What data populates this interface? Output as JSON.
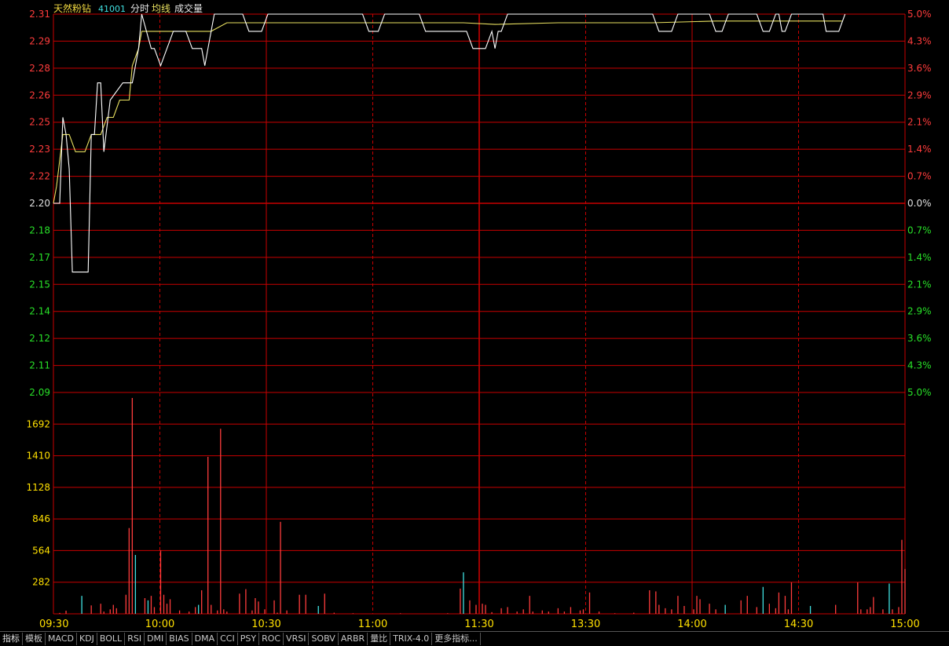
{
  "header": {
    "name": "天然粉钻",
    "code": "41001",
    "tag_minute": "分时",
    "tag_avg": "均线",
    "tag_volume": "成交量"
  },
  "colors": {
    "grid": "#c80000",
    "up": "#ff3c3c",
    "down": "#28e028",
    "neutral": "#e0e0e0",
    "price_line": "#ffffff",
    "avg_line": "#e8e060",
    "vol_up": "#ff3c3c",
    "vol_down": "#40e0e0",
    "vol_label": "#ffe000",
    "code": "#40e0e0",
    "tag": "#e8e060"
  },
  "price_axis": {
    "left_labels": [
      "2.31",
      "2.29",
      "2.28",
      "2.26",
      "2.25",
      "2.23",
      "2.22",
      "2.20",
      "2.18",
      "2.17",
      "2.15",
      "2.14",
      "2.12",
      "2.11",
      "2.09"
    ],
    "right_labels": [
      "5.0%",
      "4.3%",
      "3.6%",
      "2.9%",
      "2.1%",
      "1.4%",
      "0.7%",
      "0.0%",
      "0.7%",
      "1.4%",
      "2.1%",
      "2.9%",
      "3.6%",
      "4.3%",
      "5.0%"
    ],
    "base_index": 7,
    "prev_close": 2.2,
    "max": 2.31,
    "min": 2.09
  },
  "volume_axis": {
    "labels": [
      "1692",
      "1410",
      "1128",
      "846",
      "564",
      "282"
    ],
    "max": 1974
  },
  "time_axis": {
    "labels": [
      "09:30",
      "10:00",
      "10:30",
      "11:00",
      "11:30",
      "13:30",
      "14:00",
      "14:30",
      "15:00"
    ]
  },
  "chart_data": {
    "type": "line",
    "x_range": [
      "09:30",
      "15:00"
    ],
    "total_minutes": 240,
    "price_series": {
      "name": "分时",
      "points": [
        [
          0,
          2.2
        ],
        [
          2,
          2.2
        ],
        [
          3,
          2.25
        ],
        [
          4,
          2.24
        ],
        [
          5,
          2.22
        ],
        [
          6,
          2.16
        ],
        [
          11,
          2.16
        ],
        [
          12,
          2.24
        ],
        [
          13,
          2.24
        ],
        [
          14,
          2.27
        ],
        [
          15,
          2.27
        ],
        [
          16,
          2.23
        ],
        [
          18,
          2.26
        ],
        [
          22,
          2.27
        ],
        [
          25,
          2.27
        ],
        [
          27,
          2.29
        ],
        [
          28,
          2.31
        ],
        [
          31,
          2.29
        ],
        [
          32,
          2.29
        ],
        [
          34,
          2.28
        ],
        [
          36,
          2.29
        ],
        [
          38,
          2.3
        ],
        [
          42,
          2.3
        ],
        [
          44,
          2.29
        ],
        [
          47,
          2.29
        ],
        [
          48,
          2.28
        ],
        [
          49,
          2.29
        ],
        [
          51,
          2.31
        ],
        [
          60,
          2.31
        ],
        [
          62,
          2.3
        ],
        [
          66,
          2.3
        ],
        [
          68,
          2.31
        ],
        [
          98,
          2.31
        ],
        [
          100,
          2.3
        ],
        [
          103,
          2.3
        ],
        [
          105,
          2.31
        ],
        [
          116,
          2.31
        ],
        [
          118,
          2.3
        ],
        [
          131,
          2.3
        ],
        [
          133,
          2.29
        ],
        [
          137,
          2.29
        ],
        [
          139,
          2.3
        ],
        [
          140,
          2.29
        ],
        [
          141,
          2.3
        ],
        [
          142,
          2.3
        ],
        [
          144,
          2.31
        ],
        [
          190,
          2.31
        ],
        [
          192,
          2.3
        ],
        [
          196,
          2.3
        ],
        [
          198,
          2.31
        ],
        [
          208,
          2.31
        ],
        [
          210,
          2.3
        ],
        [
          212,
          2.3
        ],
        [
          214,
          2.31
        ],
        [
          223,
          2.31
        ],
        [
          225,
          2.3
        ],
        [
          227,
          2.3
        ],
        [
          229,
          2.31
        ],
        [
          230,
          2.31
        ],
        [
          231,
          2.3
        ],
        [
          232,
          2.3
        ],
        [
          234,
          2.31
        ],
        [
          244,
          2.31
        ],
        [
          245,
          2.3
        ],
        [
          249,
          2.3
        ],
        [
          251,
          2.31
        ]
      ]
    },
    "avg_series": {
      "name": "均线",
      "points": [
        [
          0,
          2.2
        ],
        [
          1,
          2.21
        ],
        [
          3,
          2.24
        ],
        [
          5,
          2.24
        ],
        [
          7,
          2.23
        ],
        [
          10,
          2.23
        ],
        [
          12,
          2.24
        ],
        [
          15,
          2.24
        ],
        [
          17,
          2.25
        ],
        [
          19,
          2.25
        ],
        [
          21,
          2.26
        ],
        [
          24,
          2.26
        ],
        [
          25,
          2.28
        ],
        [
          27,
          2.29
        ],
        [
          28,
          2.3
        ],
        [
          33,
          2.3
        ],
        [
          38,
          2.3
        ],
        [
          40,
          2.3
        ],
        [
          50,
          2.3
        ],
        [
          55,
          2.305
        ],
        [
          60,
          2.305
        ],
        [
          80,
          2.305
        ],
        [
          110,
          2.305
        ],
        [
          130,
          2.305
        ],
        [
          140,
          2.304
        ],
        [
          160,
          2.305
        ],
        [
          190,
          2.305
        ],
        [
          210,
          2.306
        ],
        [
          250,
          2.306
        ]
      ]
    },
    "volume_bars": {
      "name": "成交量",
      "bars": [
        [
          2,
          8,
          "up"
        ],
        [
          4,
          28,
          "up"
        ],
        [
          9,
          160,
          "down"
        ],
        [
          12,
          75,
          "up"
        ],
        [
          15,
          90,
          "up"
        ],
        [
          16,
          20,
          "up"
        ],
        [
          18,
          40,
          "up"
        ],
        [
          19,
          80,
          "up"
        ],
        [
          20,
          50,
          "up"
        ],
        [
          23,
          170,
          "up"
        ],
        [
          24,
          765,
          "up"
        ],
        [
          25,
          1925,
          "up"
        ],
        [
          26,
          525,
          "down"
        ],
        [
          29,
          140,
          "up"
        ],
        [
          30,
          120,
          "down"
        ],
        [
          31,
          160,
          "up"
        ],
        [
          32,
          60,
          "up"
        ],
        [
          34,
          565,
          "up"
        ],
        [
          35,
          170,
          "up"
        ],
        [
          36,
          90,
          "up"
        ],
        [
          37,
          130,
          "up"
        ],
        [
          40,
          30,
          "up"
        ],
        [
          43,
          20,
          "up"
        ],
        [
          45,
          60,
          "up"
        ],
        [
          46,
          80,
          "down"
        ],
        [
          47,
          210,
          "up"
        ],
        [
          49,
          1400,
          "up"
        ],
        [
          50,
          80,
          "up"
        ],
        [
          52,
          30,
          "up"
        ],
        [
          53,
          1650,
          "up"
        ],
        [
          54,
          40,
          "up"
        ],
        [
          55,
          20,
          "up"
        ],
        [
          59,
          180,
          "up"
        ],
        [
          61,
          220,
          "up"
        ],
        [
          63,
          30,
          "up"
        ],
        [
          64,
          140,
          "up"
        ],
        [
          65,
          110,
          "up"
        ],
        [
          67,
          40,
          "up"
        ],
        [
          70,
          120,
          "up"
        ],
        [
          71,
          10,
          "up"
        ],
        [
          72,
          820,
          "up"
        ],
        [
          74,
          30,
          "up"
        ],
        [
          78,
          170,
          "up"
        ],
        [
          80,
          170,
          "up"
        ],
        [
          84,
          70,
          "down"
        ],
        [
          86,
          180,
          "up"
        ],
        [
          89,
          10,
          "up"
        ],
        [
          95,
          5,
          "up"
        ],
        [
          110,
          5,
          "up"
        ],
        [
          125,
          5,
          "up"
        ],
        [
          129,
          225,
          "up"
        ],
        [
          130,
          370,
          "down"
        ],
        [
          132,
          120,
          "up"
        ],
        [
          134,
          80,
          "up"
        ],
        [
          136,
          90,
          "up"
        ],
        [
          137,
          80,
          "up"
        ],
        [
          139,
          15,
          "up"
        ],
        [
          142,
          50,
          "up"
        ],
        [
          144,
          60,
          "up"
        ],
        [
          147,
          20,
          "up"
        ],
        [
          149,
          40,
          "up"
        ],
        [
          151,
          160,
          "up"
        ],
        [
          152,
          20,
          "up"
        ],
        [
          155,
          30,
          "up"
        ],
        [
          157,
          20,
          "up"
        ],
        [
          160,
          50,
          "up"
        ],
        [
          162,
          20,
          "up"
        ],
        [
          164,
          60,
          "up"
        ],
        [
          167,
          30,
          "up"
        ],
        [
          168,
          40,
          "up"
        ],
        [
          170,
          190,
          "up"
        ],
        [
          173,
          20,
          "up"
        ],
        [
          178,
          5,
          "up"
        ],
        [
          184,
          10,
          "up"
        ],
        [
          189,
          210,
          "up"
        ],
        [
          191,
          200,
          "up"
        ],
        [
          192,
          80,
          "up"
        ],
        [
          194,
          50,
          "up"
        ],
        [
          196,
          40,
          "up"
        ],
        [
          198,
          160,
          "up"
        ],
        [
          200,
          70,
          "up"
        ],
        [
          203,
          40,
          "up"
        ],
        [
          204,
          160,
          "up"
        ],
        [
          205,
          130,
          "up"
        ],
        [
          208,
          90,
          "up"
        ],
        [
          210,
          40,
          "up"
        ],
        [
          213,
          80,
          "down"
        ],
        [
          218,
          120,
          "up"
        ],
        [
          220,
          160,
          "up"
        ],
        [
          223,
          60,
          "up"
        ],
        [
          225,
          240,
          "down"
        ],
        [
          227,
          90,
          "up"
        ],
        [
          229,
          50,
          "up"
        ],
        [
          230,
          190,
          "up"
        ],
        [
          232,
          160,
          "up"
        ],
        [
          233,
          40,
          "up"
        ],
        [
          234,
          280,
          "up"
        ],
        [
          240,
          70,
          "down"
        ],
        [
          248,
          80,
          "up"
        ],
        [
          255,
          280,
          "up"
        ],
        [
          256,
          40,
          "up"
        ],
        [
          258,
          40,
          "up"
        ],
        [
          259,
          60,
          "up"
        ],
        [
          260,
          150,
          "up"
        ],
        [
          263,
          40,
          "up"
        ],
        [
          265,
          270,
          "down"
        ],
        [
          266,
          40,
          "up"
        ],
        [
          268,
          60,
          "up"
        ],
        [
          269,
          660,
          "up"
        ],
        [
          270,
          400,
          "up"
        ]
      ]
    }
  },
  "toolbar": {
    "tabs": [
      "指标",
      "模板",
      "MACD",
      "KDJ",
      "BOLL",
      "RSI",
      "DMI",
      "BIAS",
      "DMA",
      "CCI",
      "PSY",
      "ROC",
      "VRSI",
      "SOBV",
      "ARBR",
      "量比",
      "TRIX-4.0",
      "更多指标..."
    ]
  }
}
